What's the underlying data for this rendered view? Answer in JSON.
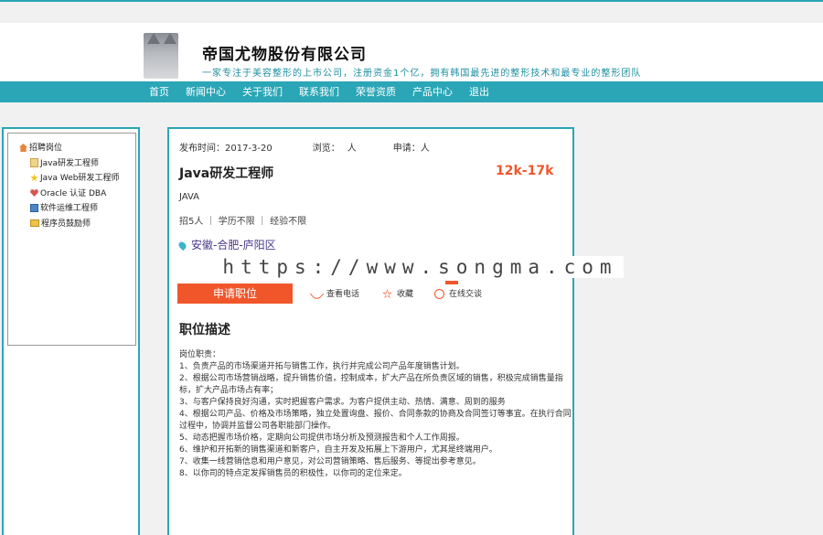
{
  "header": {
    "company_name": "帝国尤物股份有限公司",
    "slogan": "一家专注于美容整形的上市公司，注册资金1个亿，拥有韩国最先进的整形技术和最专业的整形团队"
  },
  "nav": {
    "items": [
      "首页",
      "新闻中心",
      "关于我们",
      "联系我们",
      "荣誉资质",
      "产品中心",
      "退出"
    ]
  },
  "sidebar": {
    "root": "招聘岗位",
    "items": [
      "Java研发工程师",
      "Java Web研发工程师",
      "Oracle 认证 DBA",
      "软件运维工程师",
      "程序员鼓励师"
    ]
  },
  "job": {
    "publish_label": "发布时间：",
    "publish_date": "2017-3-20",
    "views_label": "浏览：",
    "views_unit": "人",
    "applies_label": "申请：",
    "applies_unit": "人",
    "title": "Java研发工程师",
    "salary": "12k-17k",
    "tag": "JAVA",
    "requirements": "招5人 ｜ 学历不限 ｜ 经验不限",
    "location": "安徽-合肥-庐阳区",
    "apply_button": "申请职位",
    "actions": [
      "查看电话",
      "收藏",
      "在线交谈"
    ]
  },
  "description": {
    "heading": "职位描述",
    "lines": [
      "岗位职责：",
      "1、负责产品的市场渠道开拓与销售工作，执行并完成公司产品年度销售计划。",
      "2、根据公司市场营销战略，提升销售价值，控制成本，扩大产品在所负责区域的销售，积极完成销售量指标，扩大产品市场占有率；",
      "3、与客户保持良好沟通，实时把握客户需求。为客户提供主动、热情、满意、周到的服务",
      "4、根据公司产品、价格及市场策略，独立处置询盘、报价、合同条款的协商及合同签订等事宜。在执行合同过程中，协调并监督公司各职能部门操作。",
      "5、动态把握市场价格，定期向公司提供市场分析及预测报告和个人工作周报。",
      "6、维护和开拓新的销售渠道和新客户，自主开发及拓展上下游用户，尤其是终端用户。",
      "7、收集一线营销信息和用户意见，对公司营销策略、售后服务、等提出参考意见。",
      "8、以你司的特点定发挥销售员的积极性，以你司的定位来定。"
    ]
  },
  "watermark": "https://www.songma.com"
}
